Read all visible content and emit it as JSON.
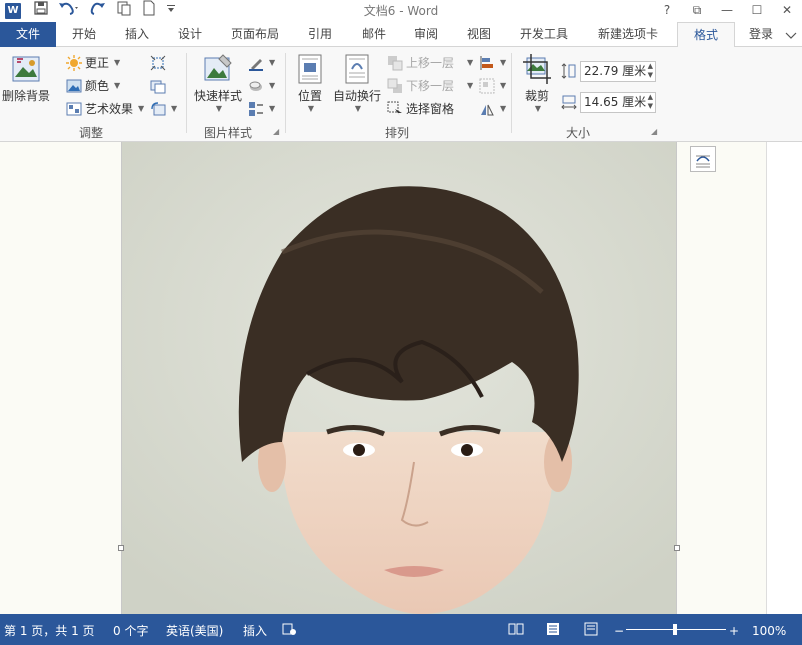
{
  "app": {
    "logo_letter": "W",
    "title": "文档6 - Word"
  },
  "quick_access": [
    "save-icon",
    "undo-icon",
    "redo-icon",
    "touch-mode-icon",
    "new-doc-icon",
    "customize-qat-icon"
  ],
  "window_controls": {
    "help": "?",
    "ribbon_options": "⧉",
    "minimize": "—",
    "restore": "☐",
    "close": "✕"
  },
  "tabs": [
    "文件",
    "开始",
    "插入",
    "设计",
    "页面布局",
    "引用",
    "邮件",
    "审阅",
    "视图",
    "开发工具",
    "新建选项卡",
    "格式"
  ],
  "active_tab": "格式",
  "login": "登录",
  "ribbon": {
    "adjust": {
      "label": "调整",
      "remove_bg": "删除背景",
      "corrections": "更正",
      "color": "颜色",
      "artistic": "艺术效果"
    },
    "picture_styles": {
      "label": "图片样式",
      "quick_styles": "快速样式"
    },
    "arrange": {
      "label": "排列",
      "position": "位置",
      "wrap_text": "自动换行",
      "bring_forward": "上移一层",
      "send_backward": "下移一层",
      "selection_pane": "选择窗格"
    },
    "size": {
      "label": "大小",
      "crop": "裁剪",
      "height": "22.79 厘米",
      "width": "14.65 厘米"
    }
  },
  "status_bar": {
    "page": "第 1 页，共 1 页",
    "words": "0 个字",
    "language": "英语(美国)",
    "mode": "插入",
    "zoom": "100%"
  },
  "colors": {
    "accent": "#2b579a",
    "ribbon_bg": "#f8f8f8",
    "page_bg": "#fbfbf5"
  }
}
